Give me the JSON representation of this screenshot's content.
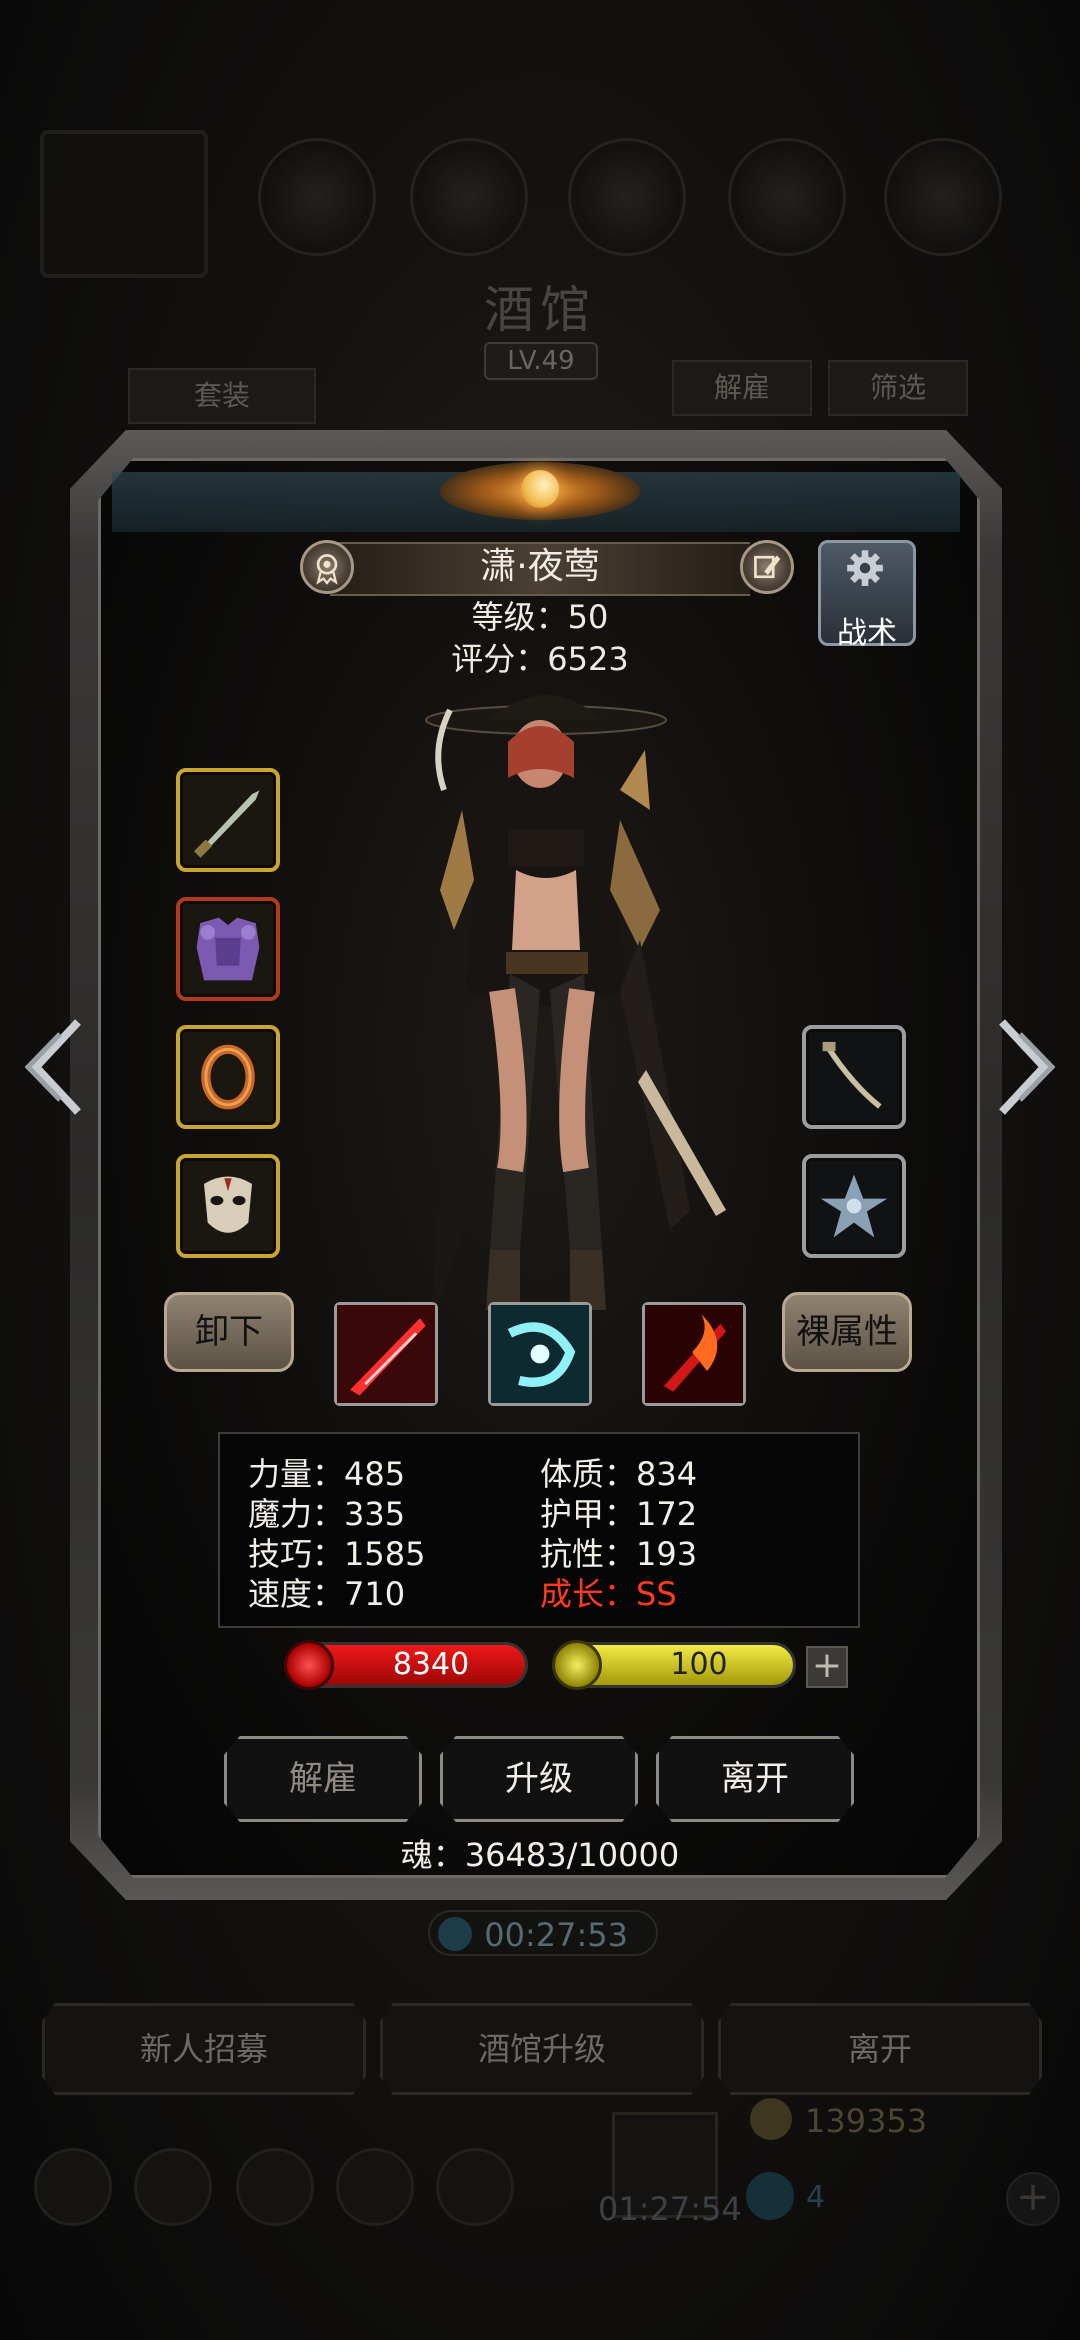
{
  "background": {
    "title": "酒馆",
    "level": "LV.49",
    "btn_set": "套装",
    "btn_fire": "解雇",
    "btn_filter": "筛选",
    "timer": "00:27:53",
    "btn_recruit": "新人招募",
    "btn_upgrade_tavern": "酒馆升级",
    "btn_leave": "离开",
    "gold": "139353",
    "timer2": "01:27:54",
    "gems": "4",
    "plus": "+"
  },
  "hero": {
    "name": "潇·夜莺",
    "level_text": "等级：50",
    "score_text": "评分：6523"
  },
  "tactics_label": "战术",
  "equipment": {
    "left": [
      "weapon-dagger-icon",
      "armor-purple-icon",
      "ring-gold-icon",
      "mask-icon"
    ],
    "right": [
      "bow-icon",
      "emblem-star-icon"
    ]
  },
  "buttons": {
    "unequip": "卸下",
    "base_attr": "裸属性"
  },
  "skills": [
    "red-slash-skill-icon",
    "cyan-swirl-skill-icon",
    "fire-blade-skill-icon"
  ],
  "stats": {
    "left": [
      "力量：485",
      "魔力：335",
      "技巧：1585",
      "速度：710"
    ],
    "right": [
      "体质：834",
      "护甲：172",
      "抗性：193"
    ],
    "growth": "成长：SS"
  },
  "bars": {
    "hp": "8340",
    "energy": "100",
    "plus": "+"
  },
  "actions": {
    "fire": "解雇",
    "upgrade": "升级",
    "leave": "离开"
  },
  "soul": "魂：36483/10000",
  "colors": {
    "gold_border": "#c9a531",
    "red_border": "#b23a1c",
    "growth_red": "#ff3a1e",
    "hp_red": "#e01414",
    "energy_yellow": "#e6dc30"
  }
}
